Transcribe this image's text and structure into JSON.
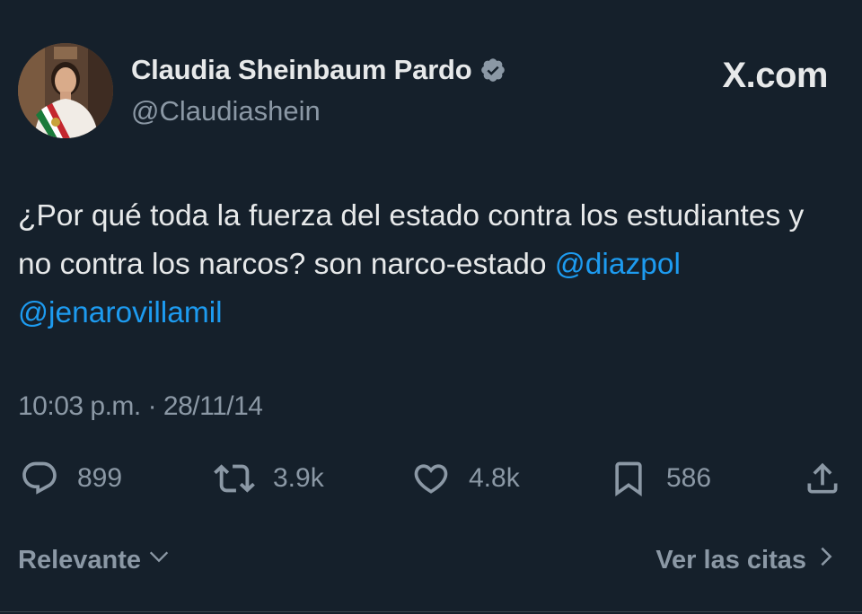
{
  "header": {
    "display_name": "Claudia Sheinbaum Pardo",
    "handle": "@Claudiashein",
    "verified_icon": "verified-badge-icon",
    "brand": "X.com"
  },
  "tweet": {
    "text_before": "¿Por qué toda la fuerza del estado contra los estudiantes y no contra los narcos? son narco-estado ",
    "mention_1": "@diazpol",
    "separator": " ",
    "mention_2": "@jenarovillamil",
    "timestamp": "10:03 p.m. · 28/11/14"
  },
  "actions": {
    "reply": {
      "icon": "reply-icon",
      "count": "899"
    },
    "retweet": {
      "icon": "retweet-icon",
      "count": "3.9k"
    },
    "like": {
      "icon": "heart-icon",
      "count": "4.8k"
    },
    "bookmark": {
      "icon": "bookmark-icon",
      "count": "586"
    },
    "share": {
      "icon": "share-icon"
    }
  },
  "footer": {
    "sort_label": "Relevante",
    "quotes_label": "Ver las citas"
  },
  "colors": {
    "background": "#15202b",
    "text": "#e7e9ea",
    "muted": "#8b98a5",
    "link": "#1d9bf0"
  }
}
